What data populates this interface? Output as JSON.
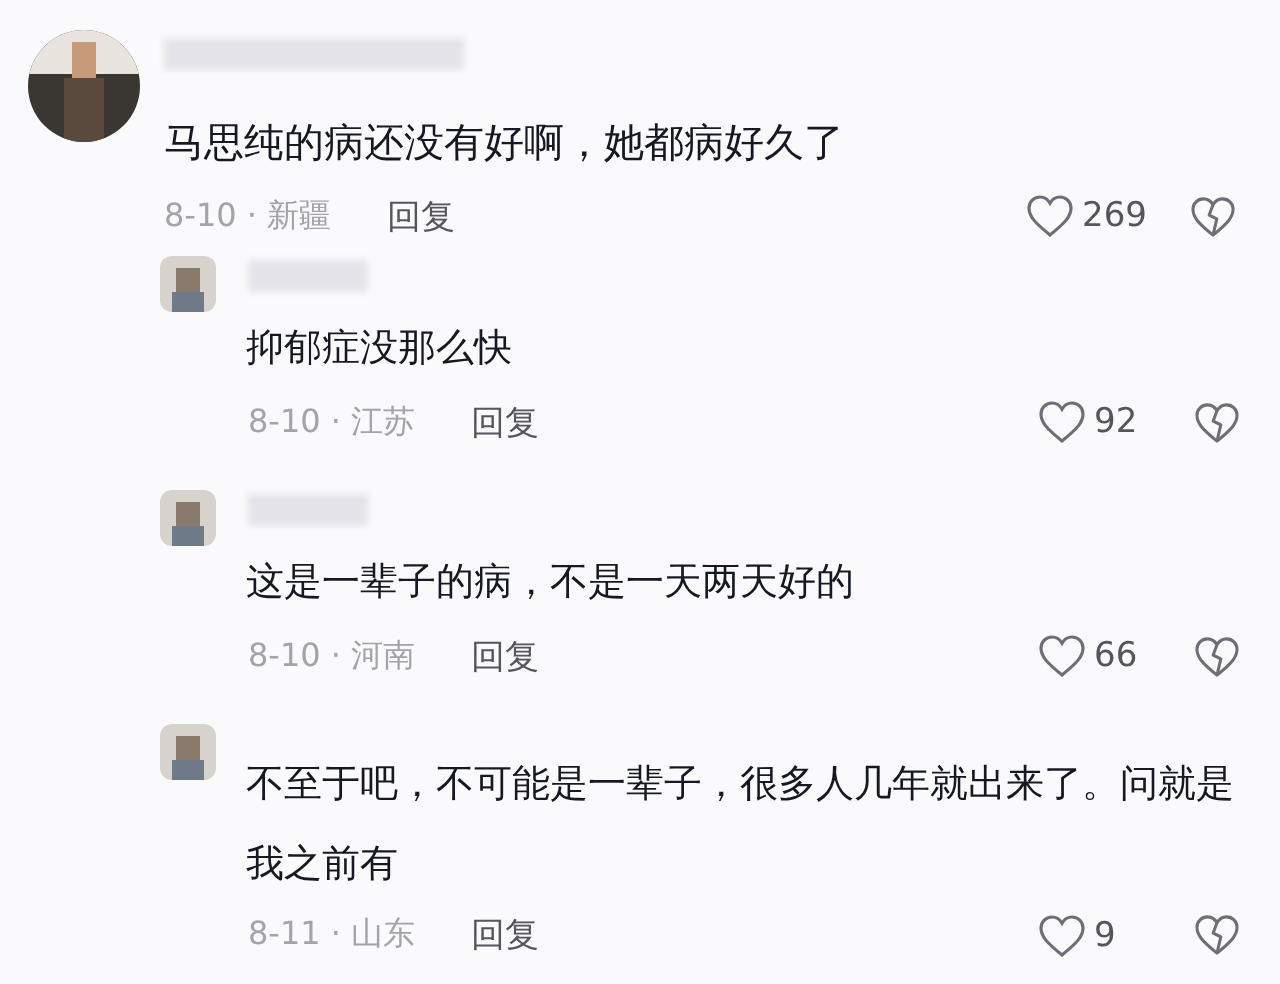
{
  "comments": [
    {
      "text": "马思纯的病还没有好啊，她都病好久了",
      "date_region": "8-10 · 新疆",
      "reply": "回复",
      "likes": "269",
      "replies": [
        {
          "text": "抑郁症没那么快",
          "date_region": "8-10 · 江苏",
          "reply": "回复",
          "likes": "92"
        },
        {
          "text": "这是一辈子的病，不是一天两天好的",
          "date_region": "8-10 · 河南",
          "reply": "回复",
          "likes": "66"
        },
        {
          "text": "不至于吧，不可能是一辈子，很多人几年就出来了。问就是我之前有",
          "date_region": "8-11 · 山东",
          "reply": "回复",
          "likes": "9"
        }
      ]
    }
  ]
}
